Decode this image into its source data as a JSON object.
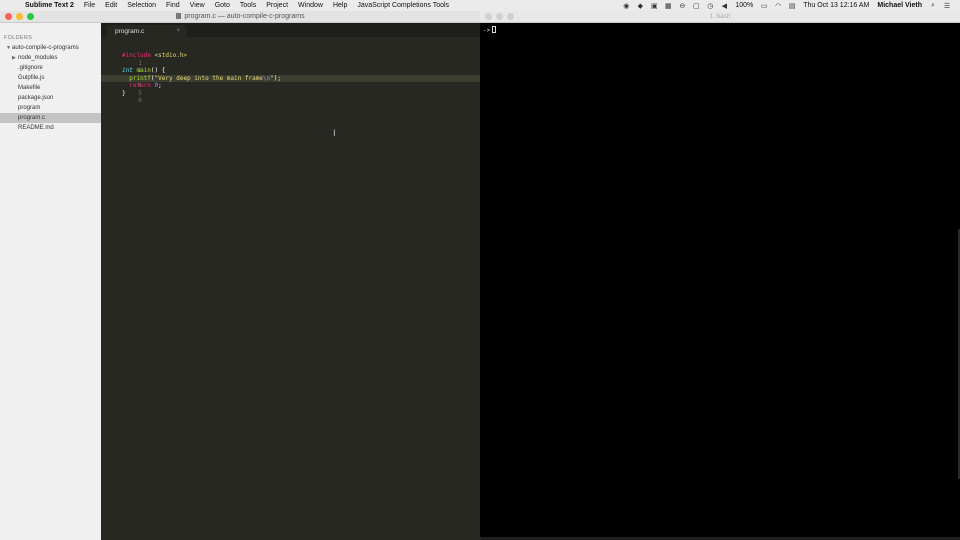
{
  "menubar": {
    "app_name": "Sublime Text 2",
    "menus": [
      "File",
      "Edit",
      "Selection",
      "Find",
      "View",
      "Goto",
      "Tools",
      "Project",
      "Window",
      "Help",
      "JavaScript Completions Tools"
    ],
    "battery": "100%",
    "datetime": "Thu Oct 13  12:16 AM",
    "user": "Michael Vieth",
    "status_icons": [
      "record-icon",
      "dropbox-icon",
      "screen-icon",
      "grid-icon",
      "circle-icon",
      "lock-icon",
      "time-machine-icon",
      "volume-icon",
      "battery-icon",
      "wifi-icon",
      "display-icon",
      "search-icon",
      "list-icon"
    ]
  },
  "sublime": {
    "window_title": "program.c — auto-compile-c-programs",
    "sidebar": {
      "header": "FOLDERS",
      "root": "auto-compile-c-programs",
      "items": [
        {
          "label": "node_modules",
          "folder": true
        },
        {
          "label": ".gitignore"
        },
        {
          "label": "Gulpfile.js"
        },
        {
          "label": "Makefile"
        },
        {
          "label": "package.json"
        },
        {
          "label": "program"
        },
        {
          "label": "program.c",
          "selected": true
        },
        {
          "label": "README.md"
        }
      ]
    },
    "tab": {
      "label": "program.c",
      "close": "×"
    },
    "gutter": [
      "1",
      "2",
      "3",
      "4",
      "5",
      "6"
    ],
    "code": {
      "line1_directive": "#include",
      "line1_header": "<stdio.h>",
      "line3_type": "int",
      "line3_fn": "main",
      "line3_rest": "() {",
      "line4_fn": "printf",
      "line4_open": "(",
      "line4_str": "\"Very deep into the main frame",
      "line4_esc": "\\n",
      "line4_quote": "\"",
      "line4_close": ");",
      "line5_kw": "return",
      "line5_num": "0",
      "line5_semi": ";",
      "line6": "}"
    }
  },
  "terminal": {
    "title": "1. bash",
    "prompt": "->"
  }
}
